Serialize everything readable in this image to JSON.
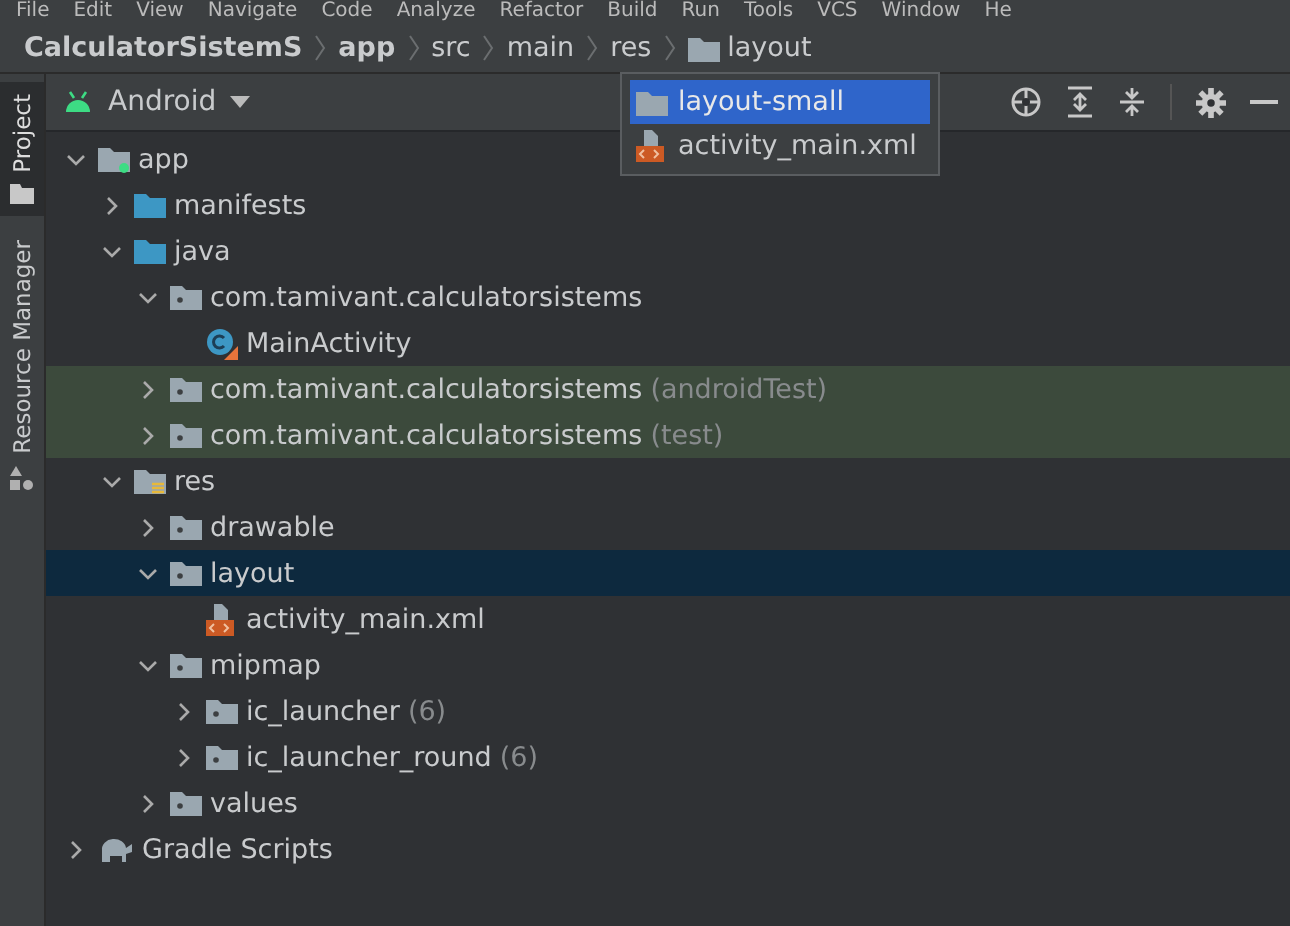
{
  "menu_bar": [
    "File",
    "Edit",
    "View",
    "Navigate",
    "Code",
    "Analyze",
    "Refactor",
    "Build",
    "Run",
    "Tools",
    "VCS",
    "Window",
    "He"
  ],
  "breadcrumb": [
    {
      "label": "CalculatorSistemS",
      "kind": "project"
    },
    {
      "label": "app",
      "kind": "project"
    },
    {
      "label": "src",
      "kind": "dir"
    },
    {
      "label": "main",
      "kind": "dir"
    },
    {
      "label": "res",
      "kind": "dir"
    },
    {
      "label": "layout",
      "kind": "folder"
    }
  ],
  "side_tabs": [
    {
      "label": "Project",
      "selected": true,
      "kind": "folder"
    },
    {
      "label": "Resource Manager",
      "selected": false,
      "kind": "shapes"
    }
  ],
  "view_selector": {
    "label": "Android"
  },
  "popup": [
    {
      "label": "layout-small",
      "kind": "folder",
      "selected": true
    },
    {
      "label": "activity_main.xml",
      "kind": "xml",
      "selected": false
    }
  ],
  "tree": [
    {
      "label": "app",
      "kind": "module",
      "expanded": true,
      "selected": false,
      "highlighted": false,
      "children": [
        {
          "label": "manifests",
          "kind": "blue-folder",
          "expanded": false,
          "selected": false,
          "highlighted": false
        },
        {
          "label": "java",
          "kind": "blue-folder",
          "expanded": true,
          "selected": false,
          "highlighted": false,
          "children": [
            {
              "label": "com.tamivant.calculatorsistems",
              "kind": "package",
              "expanded": true,
              "selected": false,
              "highlighted": false,
              "children": [
                {
                  "label": "MainActivity",
                  "kind": "class",
                  "selected": false,
                  "highlighted": false
                }
              ]
            },
            {
              "label": "com.tamivant.calculatorsistems",
              "suffix": "(androidTest)",
              "kind": "package",
              "expanded": false,
              "selected": false,
              "highlighted": true
            },
            {
              "label": "com.tamivant.calculatorsistems",
              "suffix": "(test)",
              "kind": "package",
              "expanded": false,
              "selected": false,
              "highlighted": true
            }
          ]
        },
        {
          "label": "res",
          "kind": "res",
          "expanded": true,
          "selected": false,
          "highlighted": false,
          "children": [
            {
              "label": "drawable",
              "kind": "package",
              "expanded": false,
              "selected": false,
              "highlighted": false
            },
            {
              "label": "layout",
              "kind": "package",
              "expanded": true,
              "selected": true,
              "highlighted": false,
              "children": [
                {
                  "label": "activity_main.xml",
                  "kind": "xml",
                  "selected": false,
                  "highlighted": false
                }
              ]
            },
            {
              "label": "mipmap",
              "kind": "package",
              "expanded": true,
              "selected": false,
              "highlighted": false,
              "children": [
                {
                  "label": "ic_launcher",
                  "suffix": "(6)",
                  "kind": "package",
                  "expanded": false,
                  "selected": false,
                  "highlighted": false
                },
                {
                  "label": "ic_launcher_round",
                  "suffix": "(6)",
                  "kind": "package",
                  "expanded": false,
                  "selected": false,
                  "highlighted": false
                }
              ]
            },
            {
              "label": "values",
              "kind": "package",
              "expanded": false,
              "selected": false,
              "highlighted": false
            }
          ]
        }
      ]
    },
    {
      "label": "Gradle Scripts",
      "kind": "gradle",
      "expanded": false,
      "selected": false,
      "highlighted": false
    }
  ]
}
